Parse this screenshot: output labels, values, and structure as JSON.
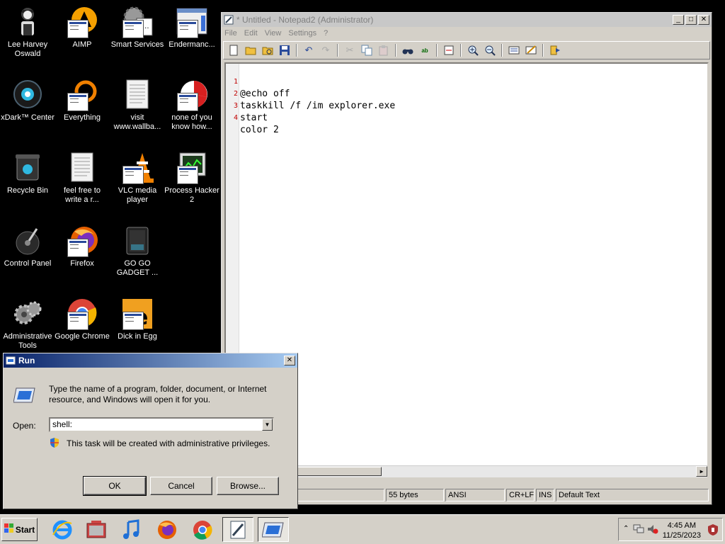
{
  "desktop": {
    "icons": [
      {
        "label": "Lee Harvey Oswald"
      },
      {
        "label": "AIMP"
      },
      {
        "label": "Smart Services"
      },
      {
        "label": "Endermanc..."
      },
      {
        "label": "xDark™ Center"
      },
      {
        "label": "Everything"
      },
      {
        "label": "visit www.wallba..."
      },
      {
        "label": "none of you know how..."
      },
      {
        "label": "Recycle Bin"
      },
      {
        "label": "feel free to write a r..."
      },
      {
        "label": "VLC media player"
      },
      {
        "label": "Process Hacker 2"
      },
      {
        "label": "Control Panel"
      },
      {
        "label": "Firefox"
      },
      {
        "label": "GO GO GADGET ..."
      },
      {
        "label": "Administrative Tools"
      },
      {
        "label": "Google Chrome"
      },
      {
        "label": "Dick in Egg"
      }
    ]
  },
  "notepad": {
    "title": "* Untitled - Notepad2 (Administrator)",
    "menu": [
      "File",
      "Edit",
      "View",
      "Settings",
      "?"
    ],
    "lines": [
      {
        "no": "1",
        "text": "@echo off"
      },
      {
        "no": "2",
        "text": "taskkill /f /im explorer.exe"
      },
      {
        "no": "3",
        "text": "start"
      },
      {
        "no": "4",
        "text": "color 2"
      }
    ],
    "status": {
      "size": "55 bytes",
      "encoding": "ANSI",
      "eol": "CR+LF",
      "mode": "INS",
      "scheme": "Default Text"
    }
  },
  "run": {
    "title": "Run",
    "description": "Type the name of a program, folder, document, or Internet resource, and Windows will open it for you.",
    "open_label": "Open:",
    "open_value": "shell:",
    "admin_note": "This task will be created with administrative privileges.",
    "ok": "OK",
    "cancel": "Cancel",
    "browse": "Browse..."
  },
  "taskbar": {
    "start": "Start",
    "time": "4:45 AM",
    "date": "11/25/2023"
  }
}
